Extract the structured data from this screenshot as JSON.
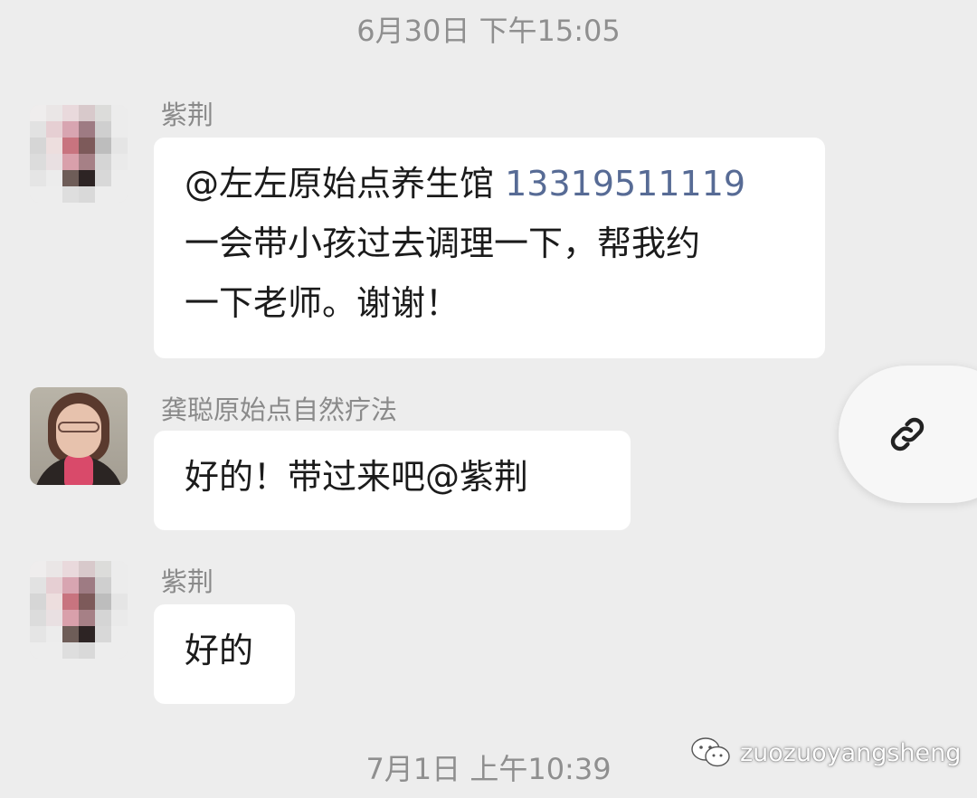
{
  "timestamps": {
    "top": "6月30日 下午15:05",
    "bottom": "7月1日 上午10:39"
  },
  "messages": [
    {
      "sender": "紫荆",
      "avatar": "pixelated-avatar",
      "lines": [
        "@左左原始点养生馆",
        "一会带小孩过去调理一下，帮我约",
        "一下老师。谢谢！"
      ],
      "phone": "13319511119"
    },
    {
      "sender": "龚聪原始点自然疗法",
      "avatar": "woman-photo-avatar",
      "text": "好的！带过来吧@紫荆"
    },
    {
      "sender": "紫荆",
      "avatar": "pixelated-avatar",
      "text": "好的"
    }
  ],
  "link_button": {
    "icon": "link-icon"
  },
  "watermark": {
    "icon": "wechat-icon",
    "text": "zuozuoyangsheng"
  },
  "colors": {
    "background": "#ededed",
    "bubble": "#ffffff",
    "phone_link": "#576b95",
    "meta_text": "#8a8a8a"
  }
}
